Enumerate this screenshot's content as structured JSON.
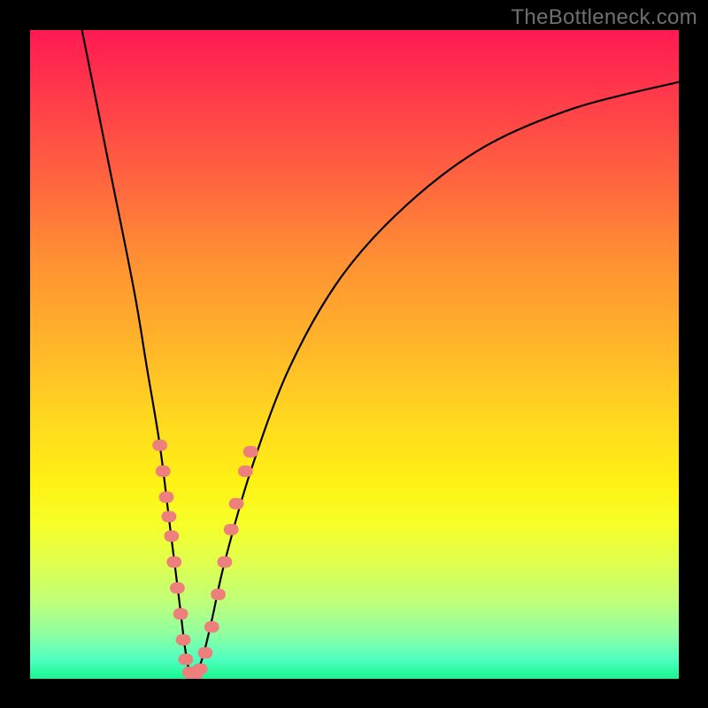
{
  "watermark": "TheBottleneck.com",
  "chart_data": {
    "type": "line",
    "title": "",
    "xlabel": "",
    "ylabel": "",
    "xlim": [
      0,
      100
    ],
    "ylim": [
      0,
      100
    ],
    "background_gradient": {
      "top": "#ff1a52",
      "middle": "#ffd81f",
      "bottom": "#17f78f"
    },
    "series": [
      {
        "name": "bottleneck-curve",
        "color": "#000000",
        "x": [
          8,
          12,
          16,
          18,
          20,
          21.5,
          23,
          24,
          25,
          26.5,
          28,
          30,
          34,
          40,
          48,
          58,
          70,
          84,
          100
        ],
        "y": [
          100,
          80,
          60,
          48,
          36,
          24,
          12,
          4,
          0,
          3,
          9,
          18,
          32,
          48,
          62,
          73,
          82,
          88,
          92
        ]
      }
    ],
    "markers": {
      "name": "highlight-dots",
      "color": "#ed7f7d",
      "size": 8,
      "points": [
        {
          "x": 20.0,
          "y": 36
        },
        {
          "x": 20.5,
          "y": 32
        },
        {
          "x": 21.0,
          "y": 28
        },
        {
          "x": 21.4,
          "y": 25
        },
        {
          "x": 21.8,
          "y": 22
        },
        {
          "x": 22.2,
          "y": 18
        },
        {
          "x": 22.7,
          "y": 14
        },
        {
          "x": 23.2,
          "y": 10
        },
        {
          "x": 23.6,
          "y": 6
        },
        {
          "x": 24.0,
          "y": 3
        },
        {
          "x": 24.6,
          "y": 1
        },
        {
          "x": 25.4,
          "y": 0.5
        },
        {
          "x": 26.2,
          "y": 1.5
        },
        {
          "x": 27.0,
          "y": 4
        },
        {
          "x": 28.0,
          "y": 8
        },
        {
          "x": 29.0,
          "y": 13
        },
        {
          "x": 30.0,
          "y": 18
        },
        {
          "x": 31.0,
          "y": 23
        },
        {
          "x": 31.8,
          "y": 27
        },
        {
          "x": 33.2,
          "y": 32
        },
        {
          "x": 34.0,
          "y": 35
        }
      ]
    }
  }
}
